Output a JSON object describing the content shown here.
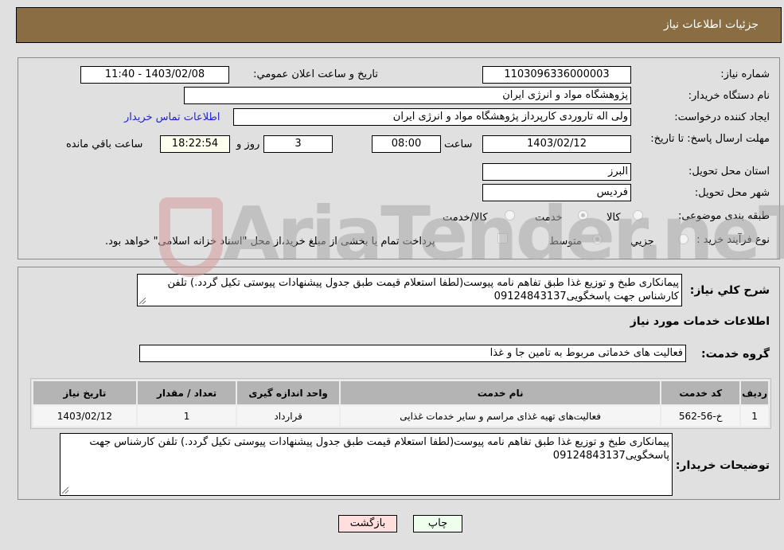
{
  "header": {
    "title": "جزئیات اطلاعات نیاز"
  },
  "fields": {
    "need_number_label": "شماره نیاز:",
    "need_number": "1103096336000003",
    "announce_label": "تاريخ و ساعت اعلان عمومي:",
    "announce_value": "1403/02/08 - 11:40",
    "buyer_org_label": "نام دستگاه خريدار:",
    "buyer_org": "پژوهشگاه مواد و انرژی ایران",
    "creator_label": "ایجاد کننده درخواست:",
    "creator": "ولی اله تاروردی کارپرداز پژوهشگاه مواد و انرژی ایران",
    "contact_link": "اطلاعات تماس خريدار",
    "deadline_label": "مهلت ارسال پاسخ: تا تاریخ:",
    "deadline_date": "1403/02/12",
    "time_label": "ساعت",
    "deadline_time": "08:00",
    "days_value": "3",
    "days_label": "روز و",
    "remaining_time": "18:22:54",
    "remaining_label": "ساعت باقي مانده",
    "province_label": "استان محل تحویل:",
    "province": "البرز",
    "city_label": "شهر محل تحویل:",
    "city": "فردیس",
    "category_label": "طبقه بندی موضوعی:",
    "category_options": [
      "کالا",
      "خدمت",
      "کالا/خدمت"
    ],
    "category_selected": "خدمت",
    "process_label": "نوع فرآیند خرید :",
    "process_options": [
      "جزيي",
      "متوسط"
    ],
    "process_selected": "متوسط",
    "treasury_text": "پرداخت تمام یا بخشی از مبلغ خرید،از محل \"اسناد خزانه اسلامی\" خواهد بود."
  },
  "description": {
    "label": "شرح کلي نياز:",
    "text": "پیمانکاری طبخ و توزیع غذا طبق تفاهم نامه پیوست(لطفا استعلام قیمت طبق جدول پیشنهادات پیوستی تکیل گردد.) تلفن کارشناس جهت پاسخگویی09124843137"
  },
  "services": {
    "section_title": "اطلاعات خدمات مورد نياز",
    "group_label": "گروه خدمت:",
    "group_value": "فعالیت های خدماتی مربوط به تامین جا و غذا",
    "columns": [
      "رديف",
      "کد خدمت",
      "نام خدمت",
      "واحد اندازه گیری",
      "تعداد / مقدار",
      "تاريخ نياز"
    ],
    "rows": [
      [
        "1",
        "خ-56-562",
        "فعالیت‌های تهیه غذای مراسم و سایر خدمات غذایی",
        "قرارداد",
        "1",
        "1403/02/12"
      ]
    ]
  },
  "buyer_notes": {
    "label": "توضيحات خريدار:",
    "text": "پیمانکاری طبخ و توزیع غذا طبق تفاهم نامه پیوست(لطفا استعلام قیمت طبق جدول پیشنهادات پیوستی تکیل گردد.) تلفن کارشناس جهت پاسخگویی09124843137"
  },
  "buttons": {
    "print": "چاپ",
    "back": "بازگشت"
  },
  "watermark": {
    "text": "AriaTender.neT"
  }
}
